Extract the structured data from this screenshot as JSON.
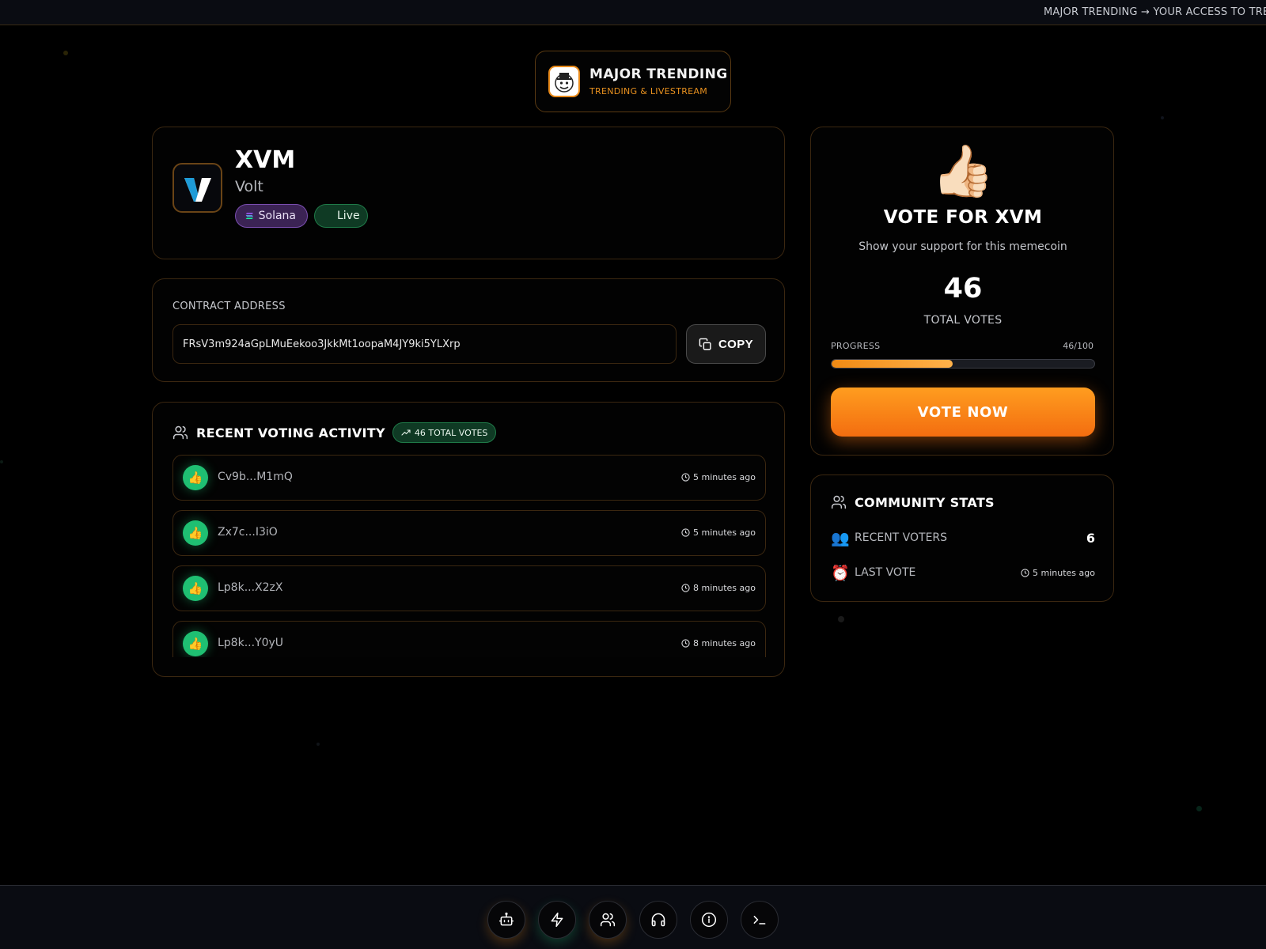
{
  "ticker": {
    "text": "MAJOR TRENDING → YOUR ACCESS TO TRE"
  },
  "brand": {
    "title": "MAJOR TRENDING",
    "subtitle": "TRENDING & LIVESTREAM",
    "logo_icon": "hat-mascot-icon",
    "accent": "#e88a1a"
  },
  "token": {
    "symbol": "XVM",
    "name": "Volt",
    "logo_icon": "volt-v-logo-icon",
    "chain": "Solana",
    "status": "Live"
  },
  "contract": {
    "label": "CONTRACT ADDRESS",
    "address": "FRsV3m924aGpLMuEekoo3JkkMt1oopaM4JY9ki5YLXrp",
    "copy_label": "COPY"
  },
  "activity": {
    "title": "RECENT VOTING ACTIVITY",
    "total_badge": "46 TOTAL VOTES",
    "items": [
      {
        "address": "Cv9b...M1mQ",
        "time": "5 minutes ago"
      },
      {
        "address": "Zx7c...I3iO",
        "time": "5 minutes ago"
      },
      {
        "address": "Lp8k...X2zX",
        "time": "8 minutes ago"
      },
      {
        "address": "Lp8k...Y0yU",
        "time": "8 minutes ago"
      }
    ]
  },
  "vote": {
    "emoji": "👍🏻",
    "title": "VOTE FOR XVM",
    "subtitle": "Show your support for this memecoin",
    "count": "46",
    "count_label": "TOTAL VOTES",
    "progress_label": "PROGRESS",
    "progress_text": "46/100",
    "progress_fraction": 0.46,
    "button_label": "VOTE NOW",
    "accent": "#f5821a"
  },
  "stats": {
    "title": "COMMUNITY STATS",
    "recent_voters_label": "RECENT VOTERS",
    "recent_voters_emoji": "👥",
    "recent_voters_value": "6",
    "last_vote_label": "LAST VOTE",
    "last_vote_emoji": "⏰",
    "last_vote_value": "5 minutes ago"
  },
  "bottom_nav": {
    "items": [
      {
        "icon": "robot-icon"
      },
      {
        "icon": "lightning-icon"
      },
      {
        "icon": "users-icon"
      },
      {
        "icon": "headphones-icon"
      },
      {
        "icon": "info-icon"
      },
      {
        "icon": "terminal-icon"
      }
    ]
  }
}
